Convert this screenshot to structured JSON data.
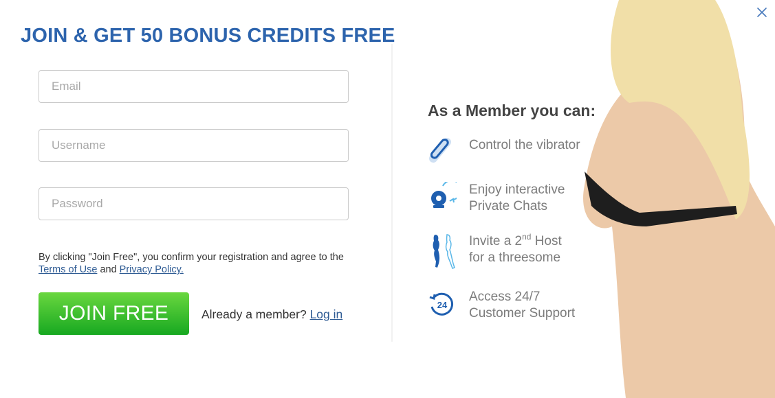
{
  "modal": {
    "title": "JOIN & GET 50 BONUS CREDITS FREE",
    "close_icon": "close-icon"
  },
  "form": {
    "email": {
      "placeholder": "Email",
      "value": ""
    },
    "username": {
      "placeholder": "Username",
      "value": ""
    },
    "password": {
      "placeholder": "Password",
      "value": ""
    },
    "terms_prefix": "By clicking \"Join Free\", you confirm your registration and agree to the ",
    "terms_link": "Terms of Use",
    "terms_and": " and ",
    "privacy_link": "Privacy Policy.",
    "join_button": "JOIN FREE",
    "member_prompt": "Already a member? ",
    "login_link": "Log in"
  },
  "benefits": {
    "title": "As a Member you can:",
    "items": [
      {
        "icon": "vibrator-icon",
        "line1": "Control the vibrator",
        "line2": ""
      },
      {
        "icon": "webcam-chat-icon",
        "line1": "Enjoy interactive",
        "line2": "Private Chats"
      },
      {
        "icon": "two-hosts-icon",
        "line1_pre": "Invite a 2",
        "line1_sup": "nd",
        "line1_post": " Host",
        "line2": "for a threesome"
      },
      {
        "icon": "support-24-icon",
        "line1": "Access 24/7",
        "line2": "Customer Support"
      }
    ]
  },
  "colors": {
    "title": "#2d64ad",
    "link": "#2d5a93",
    "button_top": "#6ad73f",
    "button_bottom": "#17a821",
    "icon_blue": "#1f5fb0"
  }
}
